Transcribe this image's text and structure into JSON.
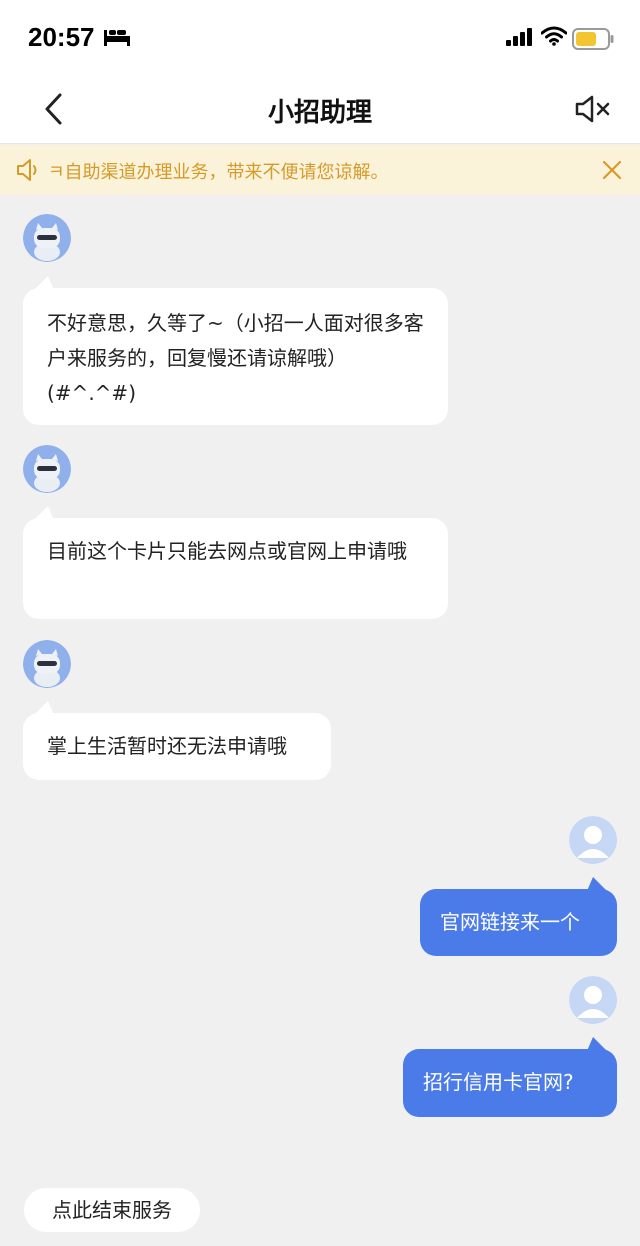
{
  "status_bar": {
    "time": "20:57",
    "icons": [
      "bed-icon",
      "signal-icon",
      "wifi-icon",
      "battery-icon"
    ]
  },
  "nav": {
    "title": "小招助理",
    "back_icon": "chevron-left-icon",
    "mute_icon": "speaker-mute-icon"
  },
  "notice": {
    "text": "ㅋ自助渠道办理业务，带来不便请您谅解。",
    "accent_color": "#d59a2a",
    "background_color": "#fbf3d9"
  },
  "messages": [
    {
      "from": "assistant",
      "text": "不好意思，久等了~（小招一人面对很多客户来服务的，回复慢还请谅解哦）(#^.^#)"
    },
    {
      "from": "assistant",
      "text": "目前这个卡片只能去网点或官网上申请哦"
    },
    {
      "from": "assistant",
      "text": "掌上生活暂时还无法申请哦"
    },
    {
      "from": "user",
      "text": "官网链接来一个"
    },
    {
      "from": "user",
      "text": "招行信用卡官网?"
    }
  ],
  "colors": {
    "user_bubble": "#4b7be8",
    "assistant_bubble": "#ffffff",
    "chat_background": "#f0f0f0"
  },
  "end_service_label": "点此结束服务"
}
